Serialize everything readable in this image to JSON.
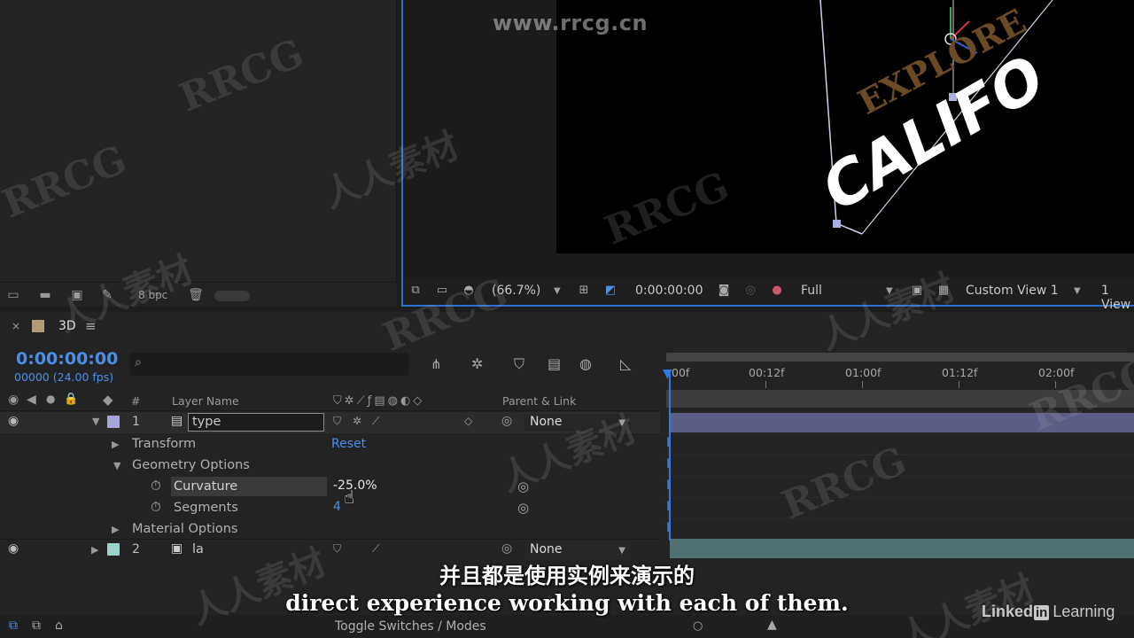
{
  "watermark": {
    "url": "www.rrcg.cn",
    "brand": "RRCG",
    "cn": "人人素材"
  },
  "project": {
    "bpc": "8 bpc"
  },
  "viewer": {
    "zoom": "(66.7%)",
    "timecode": "0:00:00:00",
    "resolution": "Full",
    "view": "Custom View 1",
    "views_count": "1 View",
    "canvas_text_main": "CALIFO",
    "canvas_text_top": "EXPLORE"
  },
  "timeline": {
    "tab_name": "3D",
    "current_time": "0:00:00:00",
    "frame_info": "00000 (24.00 fps)",
    "columns": {
      "hash": "#",
      "layer_name": "Layer Name",
      "parent": "Parent & Link"
    },
    "ruler_labels": [
      "00f",
      "00:12f",
      "01:00f",
      "01:12f",
      "02:00f"
    ],
    "layers": [
      {
        "index": "1",
        "name": "type",
        "parent": "None",
        "color": "#a5a5d8"
      },
      {
        "index": "2",
        "name": "la",
        "parent": "None",
        "color": "#9ed1cc"
      }
    ],
    "props": {
      "transform": "Transform",
      "transform_reset": "Reset",
      "geometry": "Geometry Options",
      "curvature": "Curvature",
      "curvature_value": "-25.0%",
      "segments": "Segments",
      "segments_value": "4",
      "material": "Material Options"
    },
    "footer": {
      "toggle_label": "Toggle Switches / Modes"
    }
  },
  "subtitles": {
    "cn": "并且都是使用实例来演示的",
    "en": "direct experience working with each of them."
  },
  "branding": {
    "linkedin_prefix": "Linked",
    "linkedin_in": "in",
    "linkedin_suffix": "Learning"
  }
}
